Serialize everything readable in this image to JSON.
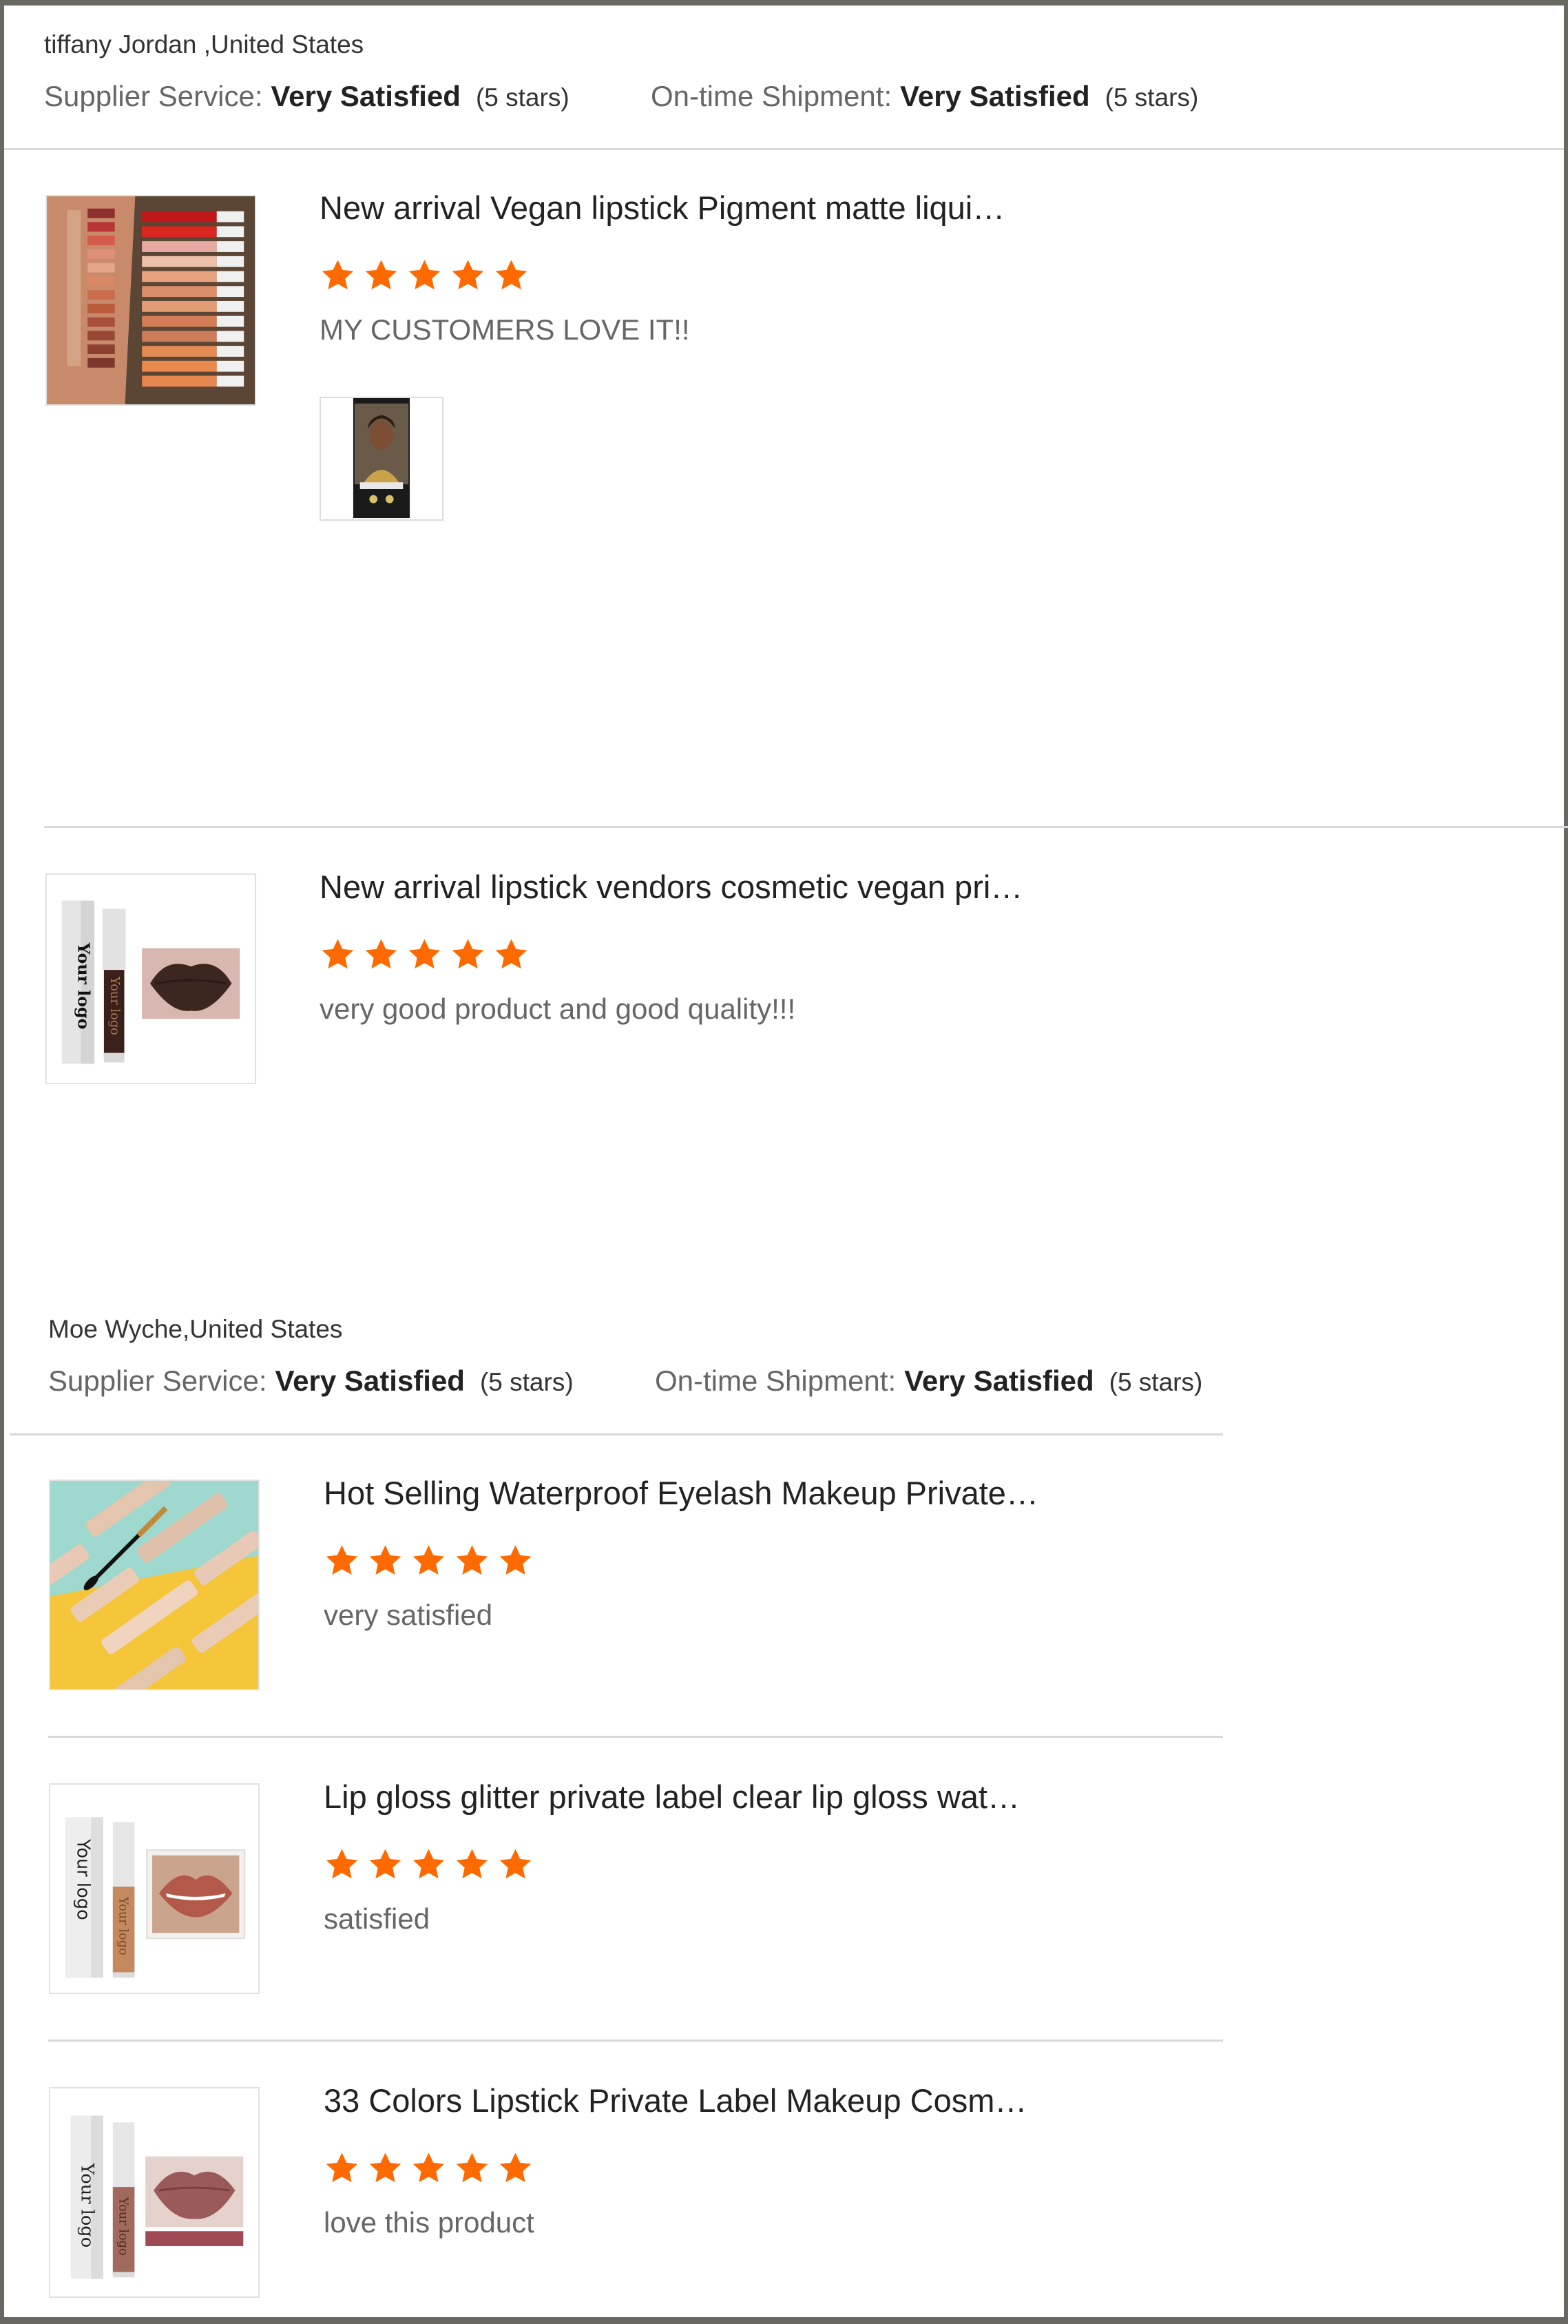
{
  "reviews": [
    {
      "reviewer": "tiffany Jordan ,United States",
      "supplier_label": "Supplier Service:",
      "supplier_value": "Very Satisfied",
      "supplier_stars": "(5 stars)",
      "shipment_label": "On-time Shipment:",
      "shipment_value": "Very Satisfied",
      "shipment_stars": "(5 stars)",
      "items": [
        {
          "title": "New arrival Vegan lipstick Pigment matte liqui…",
          "rating": 5,
          "comment": "MY CUSTOMERS LOVE IT!!",
          "image": "lipstick-swatches-image",
          "attachment": "customer-photo-thumbnail"
        },
        {
          "title": "New arrival lipstick vendors cosmetic vegan pri…",
          "rating": 5,
          "comment": "very good product and good quality!!!",
          "image": "lipstick-box-your-logo-image",
          "image_text": "Your logo"
        }
      ]
    },
    {
      "reviewer": "Moe Wyche,United States",
      "supplier_label": "Supplier Service:",
      "supplier_value": "Very Satisfied",
      "supplier_stars": "(5 stars)",
      "shipment_label": "On-time Shipment:",
      "shipment_value": "Very Satisfied",
      "shipment_stars": "(5 stars)",
      "items": [
        {
          "title": "Hot Selling Waterproof Eyelash Makeup Private…",
          "rating": 5,
          "comment": "very satisfied",
          "image": "diamond-mascara-image"
        },
        {
          "title": "Lip gloss glitter private label clear lip gloss wat…",
          "rating": 5,
          "comment": "satisfied",
          "image": "lip-gloss-box-image",
          "image_text": "Your logo"
        },
        {
          "title": "33 Colors Lipstick Private Label Makeup Cosm…",
          "rating": 5,
          "comment": "love this product",
          "image": "lipstick-box-nude-image",
          "image_text": "Your logo"
        }
      ]
    }
  ],
  "colors": {
    "star": "#ff6a00",
    "divider": "#d8d8d8",
    "frame": "#6a6863"
  }
}
